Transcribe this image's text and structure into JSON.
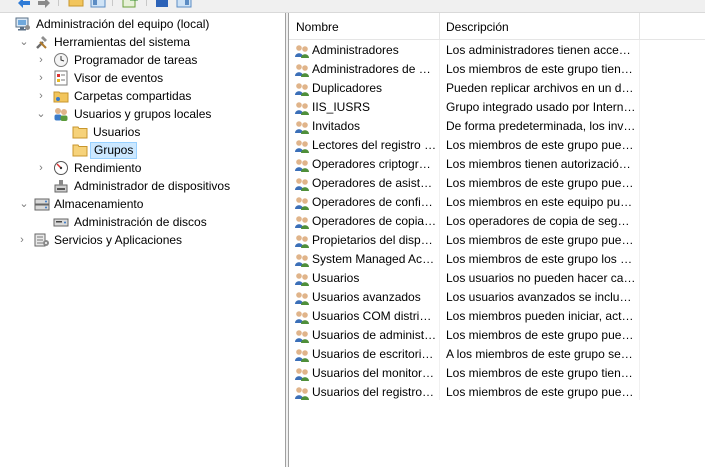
{
  "toolbar": {
    "buttons": [
      "back-icon",
      "forward-icon",
      "folder-icon",
      "properties-icon",
      "export-icon",
      "help-icon",
      "panel-icon"
    ]
  },
  "tree": {
    "root": "Administración del equipo (local)",
    "system_tools": "Herramientas del sistema",
    "task_scheduler": "Programador de tareas",
    "event_viewer": "Visor de eventos",
    "shared_folders": "Carpetas compartidas",
    "local_users_groups": "Usuarios y grupos locales",
    "users": "Usuarios",
    "groups": "Grupos",
    "performance": "Rendimiento",
    "device_manager": "Administrador de dispositivos",
    "storage": "Almacenamiento",
    "disk_management": "Administración de discos",
    "services_apps": "Servicios y Aplicaciones"
  },
  "list": {
    "columns": {
      "name": "Nombre",
      "description": "Descripción"
    },
    "rows": [
      {
        "name": "Administradores",
        "description": "Los administradores tienen acceso completo y sin restricciones"
      },
      {
        "name": "Administradores de Hyper-V",
        "description": "Los miembros de este grupo tienen acceso completo"
      },
      {
        "name": "Duplicadores",
        "description": "Pueden replicar archivos en un dominio"
      },
      {
        "name": "IIS_IUSRS",
        "description": "Grupo integrado usado por Internet Information Services"
      },
      {
        "name": "Invitados",
        "description": "De forma predeterminada, los invitados tienen el mismo acceso"
      },
      {
        "name": "Lectores del registro de eventos",
        "description": "Los miembros de este grupo pueden leer registros de eventos"
      },
      {
        "name": "Operadores criptográficos",
        "description": "Los miembros tienen autorización para realizar operaciones"
      },
      {
        "name": "Operadores de asistencia de control de acceso",
        "description": "Los miembros de este grupo pueden consultar"
      },
      {
        "name": "Operadores de configuración de red",
        "description": "Los miembros en este equipo pueden tener algunos privilegios"
      },
      {
        "name": "Operadores de copia de seguridad",
        "description": "Los operadores de copia de seguridad pueden invalidar"
      },
      {
        "name": "Propietarios del dispositivo",
        "description": "Los miembros de este grupo pueden cambiar"
      },
      {
        "name": "System Managed Accounts Group",
        "description": "Los miembros de este grupo los administra el sistema"
      },
      {
        "name": "Usuarios",
        "description": "Los usuarios no pueden hacer cambios"
      },
      {
        "name": "Usuarios avanzados",
        "description": "Los usuarios avanzados se incluyen para compatibilidad"
      },
      {
        "name": "Usuarios COM distribuidos",
        "description": "Los miembros pueden iniciar, activar y usar objetos"
      },
      {
        "name": "Usuarios de administración remota",
        "description": "Los miembros de este grupo pueden acceder"
      },
      {
        "name": "Usuarios de escritorio remoto",
        "description": "A los miembros de este grupo se les concede"
      },
      {
        "name": "Usuarios del monitor de sistema",
        "description": "Los miembros de este grupo tienen acceso"
      },
      {
        "name": "Usuarios del registro de rendimiento",
        "description": "Los miembros de este grupo pueden programar"
      }
    ]
  }
}
